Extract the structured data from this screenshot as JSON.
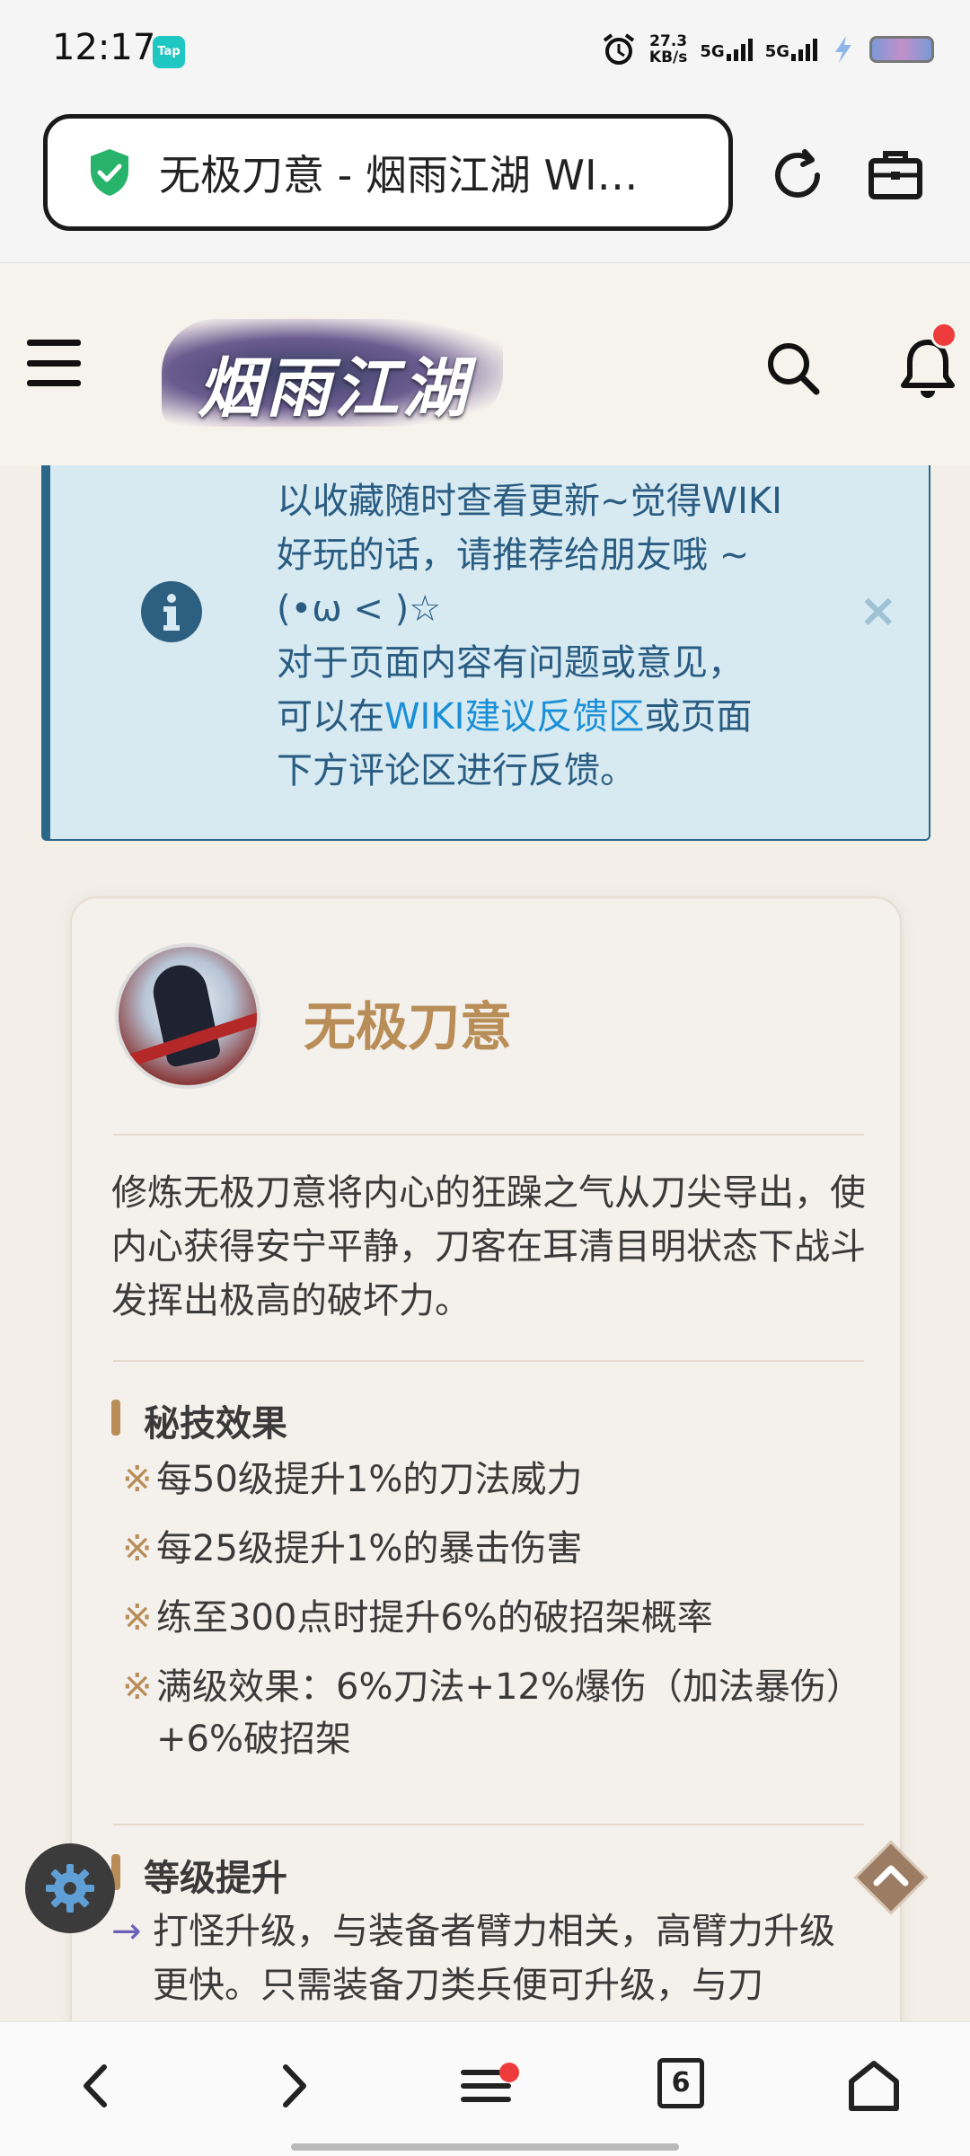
{
  "status_bar": {
    "time": "12:17",
    "app_badge": "Tap",
    "net_speed_value": "27.3",
    "net_speed_unit": "KB/s",
    "sim1": "5G",
    "sim2": "5G"
  },
  "browser": {
    "url_title": "无极刀意 - 烟雨江湖 WI…",
    "tab_count": "6"
  },
  "site": {
    "logo_text": "烟雨江湖"
  },
  "notice": {
    "line1": "以收藏随时查看更新~觉得WIKI",
    "line2": "好玩的话，请推荐给朋友哦 ~",
    "line3": "(•ω < )☆",
    "line4": "对于页面内容有问题或意见，",
    "line5_pre": "可以在",
    "line5_link": "WIKI建议反馈区",
    "line5_post": "或页面",
    "line6": "下方评论区进行反馈。",
    "close": "×"
  },
  "skill": {
    "name": "无极刀意",
    "description": "修炼无极刀意将内心的狂躁之气从刀尖导出，使内心获得安宁平静，刀客在耳清目明状态下战斗发挥出极高的破坏力。",
    "effects_title": "秘技效果",
    "effect_mark": "※",
    "effects": [
      "每50级提升1%的刀法威力",
      "每25级提升1%的暴击伤害",
      "练至300点时提升6%的破招架概率",
      "满级效果：6%刀法+12%爆伤（加法暴伤）+6%破招架"
    ],
    "level_title": "等级提升",
    "level_arrow": "→",
    "level_text": "打怪升级，与装备者臂力相关，高臂力升级更快。只需装备刀类兵便可升级，与刀"
  }
}
